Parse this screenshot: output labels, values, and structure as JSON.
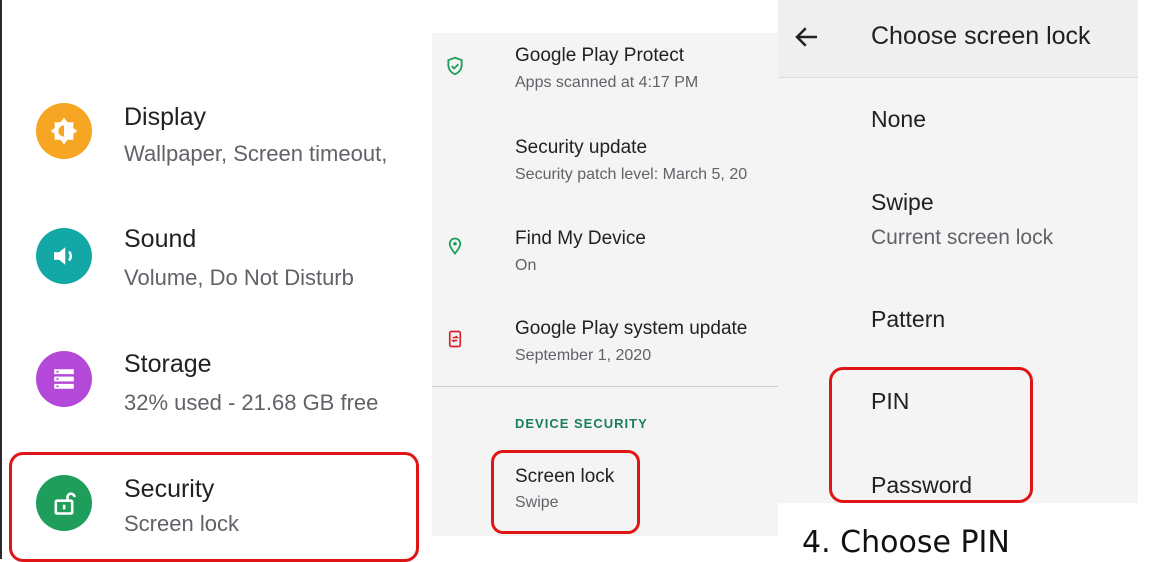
{
  "panel1": {
    "items": [
      {
        "title": "Display",
        "subtitle": "Wallpaper, Screen timeout,",
        "icon": "brightness-icon",
        "color": "#f6a623"
      },
      {
        "title": "Sound",
        "subtitle": "Volume, Do Not Disturb",
        "icon": "volume-icon",
        "color": "#13a8a6"
      },
      {
        "title": "Storage",
        "subtitle": "32% used - 21.68 GB free",
        "icon": "storage-icon",
        "color": "#b448d8"
      },
      {
        "title": "Security",
        "subtitle": "Screen lock",
        "icon": "lock-open-icon",
        "color": "#1e9e5a"
      }
    ]
  },
  "panel2": {
    "items": [
      {
        "title": "Google Play Protect",
        "subtitle": "Apps scanned at 4:17 PM",
        "icon": "shield-check-icon"
      },
      {
        "title": "Security update",
        "subtitle": "Security patch level: March 5, 20"
      },
      {
        "title": "Find My Device",
        "subtitle": "On",
        "icon": "location-pin-icon"
      },
      {
        "title": "Google Play system update",
        "subtitle": "September 1, 2020",
        "icon": "system-update-icon"
      }
    ],
    "section_header": "DEVICE SECURITY",
    "screen_lock": {
      "title": "Screen lock",
      "subtitle": "Swipe"
    }
  },
  "panel3": {
    "header_title": "Choose screen lock",
    "options": [
      {
        "label": "None"
      },
      {
        "label": "Swipe",
        "subtitle": "Current screen lock"
      },
      {
        "label": "Pattern"
      },
      {
        "label": "PIN"
      },
      {
        "label": "Password"
      }
    ]
  },
  "caption": "4. Choose PIN",
  "colors": {
    "highlight": "#e01515",
    "accent": "#1a7f5a"
  }
}
